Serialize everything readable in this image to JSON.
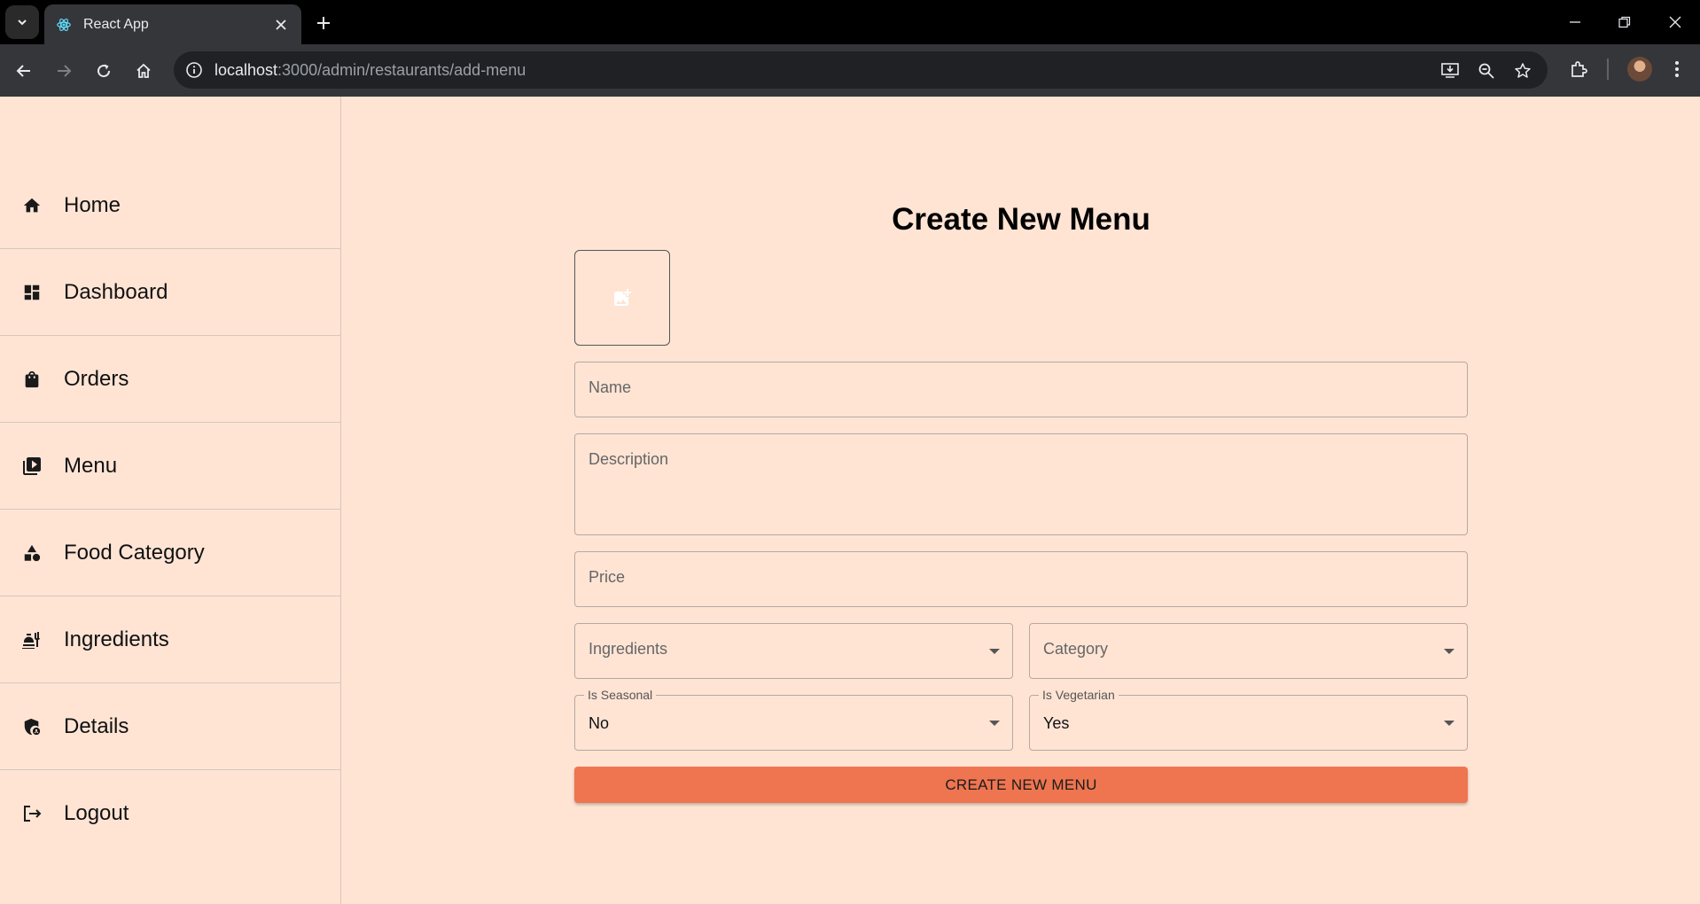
{
  "browser": {
    "tab_title": "React App",
    "url_host": "localhost",
    "url_rest": ":3000/admin/restaurants/add-menu"
  },
  "sidebar": {
    "items": [
      {
        "label": "Home",
        "icon": "home-icon"
      },
      {
        "label": "Dashboard",
        "icon": "dashboard-icon"
      },
      {
        "label": "Orders",
        "icon": "shopping-bag-icon"
      },
      {
        "label": "Menu",
        "icon": "menu-book-icon"
      },
      {
        "label": "Food Category",
        "icon": "category-icon"
      },
      {
        "label": "Ingredients",
        "icon": "ingredients-icon"
      },
      {
        "label": "Details",
        "icon": "admin-panel-icon"
      },
      {
        "label": "Logout",
        "icon": "logout-icon"
      }
    ]
  },
  "form": {
    "title": "Create New Menu",
    "name_placeholder": "Name",
    "description_placeholder": "Description",
    "price_placeholder": "Price",
    "ingredients_placeholder": "Ingredients",
    "category_placeholder": "Category",
    "seasonal_label": "Is Seasonal",
    "seasonal_value": "No",
    "vegetarian_label": "Is Vegetarian",
    "vegetarian_value": "Yes",
    "submit_label": "CREATE NEW MENU"
  },
  "colors": {
    "background": "#ffe4d4",
    "accent": "#ee7550"
  }
}
